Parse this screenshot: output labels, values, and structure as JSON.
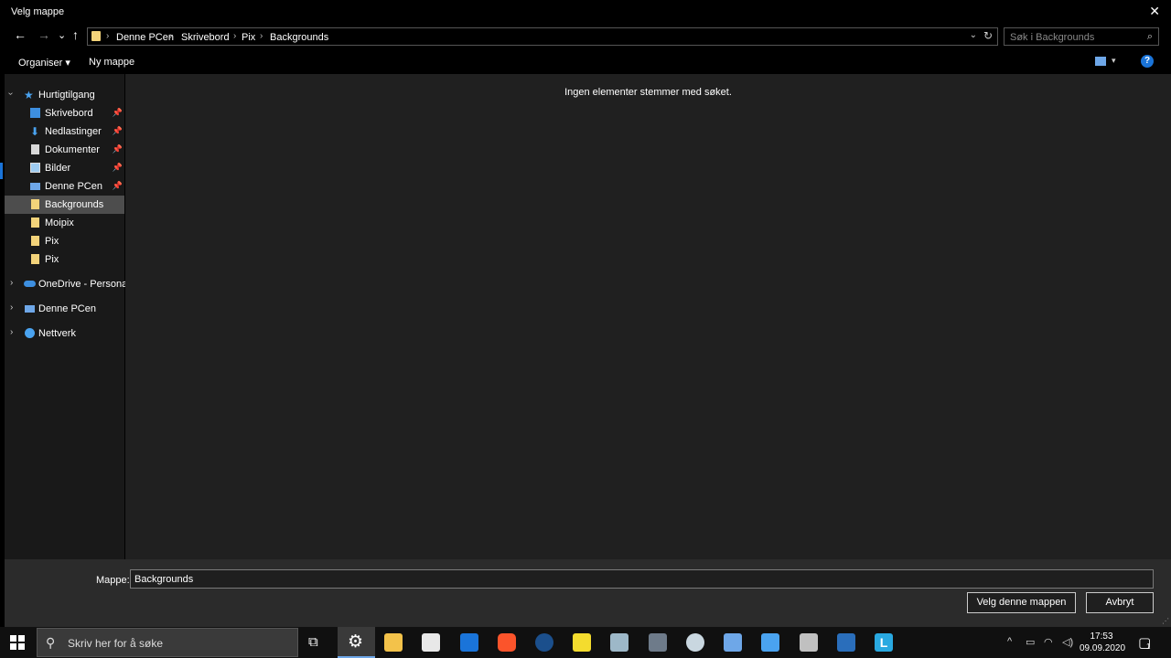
{
  "window": {
    "title": "Velg mappe",
    "close": "✕"
  },
  "nav_buttons": {
    "back": "←",
    "forward": "→",
    "recent": "⌄",
    "up": "↑"
  },
  "breadcrumb": [
    "Denne PCen",
    "Skrivebord",
    "Pix",
    "Backgrounds"
  ],
  "search": {
    "placeholder": "Søk i Backgrounds"
  },
  "toolbar": {
    "organize_label": "Organiser ▾",
    "new_folder_label": "Ny mappe",
    "help": "?"
  },
  "sidebar": {
    "quick_access": {
      "label": "Hurtigtilgang",
      "items": [
        {
          "label": "Skrivebord",
          "pinned": true
        },
        {
          "label": "Nedlastinger",
          "pinned": true
        },
        {
          "label": "Dokumenter",
          "pinned": true
        },
        {
          "label": "Bilder",
          "pinned": true
        },
        {
          "label": "Denne PCen",
          "pinned": true
        },
        {
          "label": "Backgrounds",
          "selected": true
        },
        {
          "label": "Moipix"
        },
        {
          "label": "Pix"
        },
        {
          "label": "Pix"
        }
      ]
    },
    "roots": [
      {
        "label": "OneDrive - Personal"
      },
      {
        "label": "Denne PCen"
      },
      {
        "label": "Nettverk"
      }
    ]
  },
  "content": {
    "empty_message": "Ingen elementer stemmer med søket."
  },
  "footer": {
    "folder_label": "Mappe:",
    "folder_value": "Backgrounds",
    "select_button": "Velg denne mappen",
    "cancel_button": "Avbryt"
  },
  "taskbar": {
    "search_placeholder": "Skriv her for å søke",
    "time": "17:53",
    "date": "09.09.2020",
    "notification_count": "1"
  },
  "colors": {
    "accent": "#1a74d9",
    "folder": "#f3d37a",
    "selected": "#4d4d4d"
  }
}
